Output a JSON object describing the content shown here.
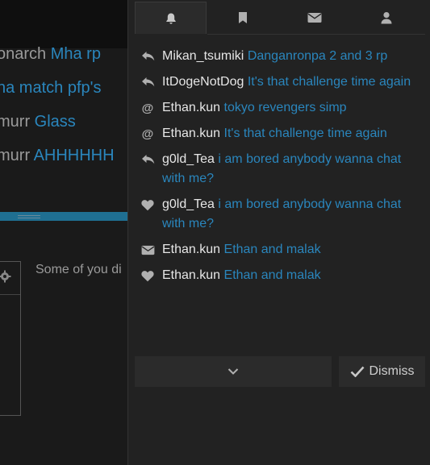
{
  "background": {
    "lines": [
      {
        "user": "onarch",
        "topic": "Mha rp"
      },
      {
        "user": "",
        "topic": "ha match pfp's"
      },
      {
        "user": "murr",
        "topic": "Glass"
      },
      {
        "user": "murr",
        "topic": "AHHHHHH"
      }
    ],
    "snippet": "Some of you di",
    "gear_icon": "gear-icon"
  },
  "tabs": [
    {
      "icon": "bell-icon",
      "active": true
    },
    {
      "icon": "bookmark-icon",
      "active": false
    },
    {
      "icon": "envelope-icon",
      "active": false
    },
    {
      "icon": "user-icon",
      "active": false
    }
  ],
  "notifications": [
    {
      "icon": "reply-icon",
      "user": "Mikan_tsumiki",
      "topic": "Danganronpa 2 and 3 rp"
    },
    {
      "icon": "reply-icon",
      "user": "ItDogeNotDog",
      "topic": "It's that challenge time again"
    },
    {
      "icon": "at-icon",
      "user": "Ethan.kun",
      "topic": "tokyo revengers simp"
    },
    {
      "icon": "at-icon",
      "user": "Ethan.kun",
      "topic": "It's that challenge time again"
    },
    {
      "icon": "reply-icon",
      "user": "g0ld_Tea",
      "topic": "i am bored anybody wanna chat with me?"
    },
    {
      "icon": "heart-icon",
      "user": "g0ld_Tea",
      "topic": "i am bored anybody wanna chat with me?"
    },
    {
      "icon": "envelope-icon",
      "user": "Ethan.kun",
      "topic": "Ethan and malak"
    },
    {
      "icon": "heart-icon",
      "user": "Ethan.kun",
      "topic": "Ethan and malak"
    }
  ],
  "footer": {
    "expand_icon": "chevron-down-icon",
    "dismiss_label": "Dismiss",
    "dismiss_icon": "check-icon"
  },
  "colors": {
    "panel": "#222222",
    "link": "#2a86bd",
    "user": "#e6e6e6",
    "icon": "#b0b0b0"
  }
}
